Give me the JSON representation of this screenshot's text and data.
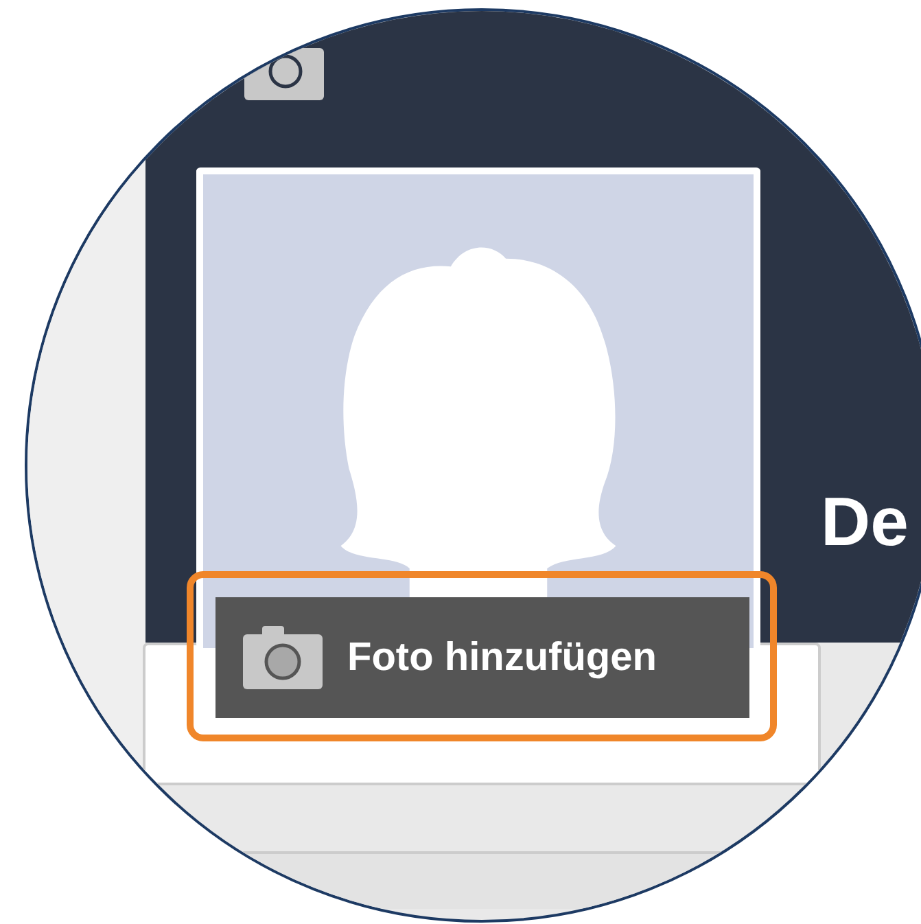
{
  "profile_photo": {
    "add_photo_button": {
      "label": "Foto hinzufügen",
      "highlighted": true
    }
  },
  "cover": {
    "name": "De"
  }
}
